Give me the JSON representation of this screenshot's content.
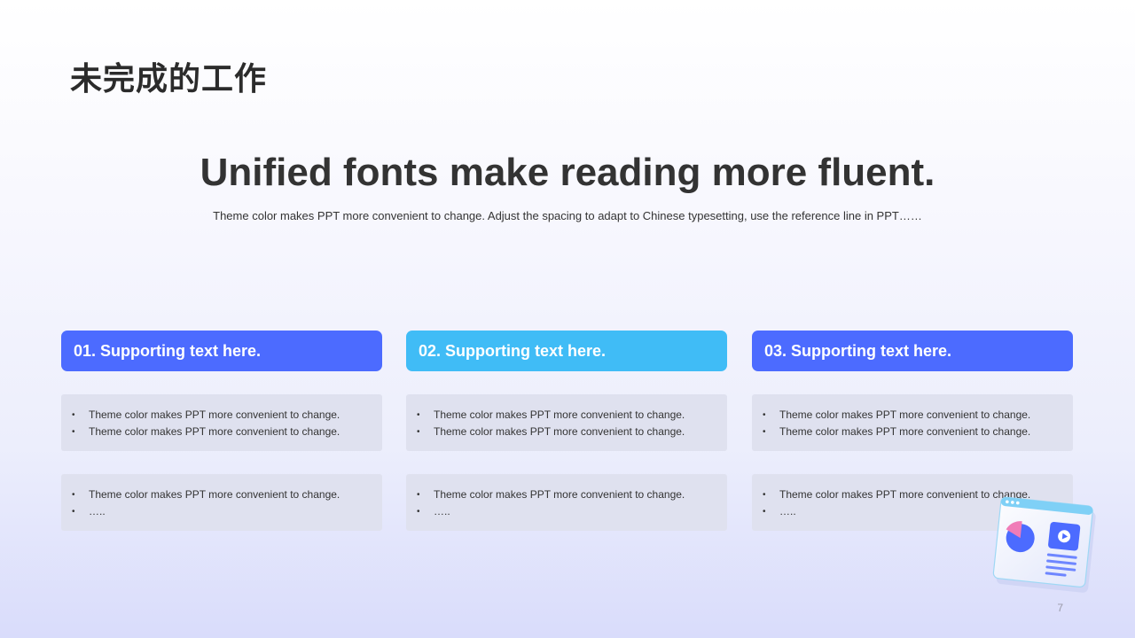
{
  "slide": {
    "title": "未完成的工作",
    "headline": "Unified fonts make reading more fluent.",
    "subline": "Theme color makes PPT more convenient to change. Adjust the spacing to adapt to Chinese typesetting, use the reference line in PPT……",
    "page_number": "7"
  },
  "colors": {
    "header_blue": "#4c6bff",
    "header_cyan": "#40bcf6",
    "box_bg": "#dfe1ef"
  },
  "columns": [
    {
      "header": "01. Supporting text here.",
      "box1": [
        "Theme color makes PPT more convenient to change.",
        "Theme color makes PPT more convenient to change."
      ],
      "box2": [
        "Theme color makes PPT more convenient to change.",
        "….."
      ]
    },
    {
      "header": "02. Supporting text here.",
      "box1": [
        "Theme color makes PPT more convenient to change.",
        "Theme color makes PPT more convenient to change."
      ],
      "box2": [
        "Theme color makes PPT more convenient to change.",
        "….."
      ]
    },
    {
      "header": "03. Supporting text here.",
      "box1": [
        "Theme color makes PPT more convenient to change.",
        "Theme color makes PPT more convenient to change."
      ],
      "box2": [
        "Theme color makes PPT more convenient to change.",
        "….."
      ]
    }
  ],
  "decoration": {
    "icon": "dashboard-window-illustration-icon"
  }
}
